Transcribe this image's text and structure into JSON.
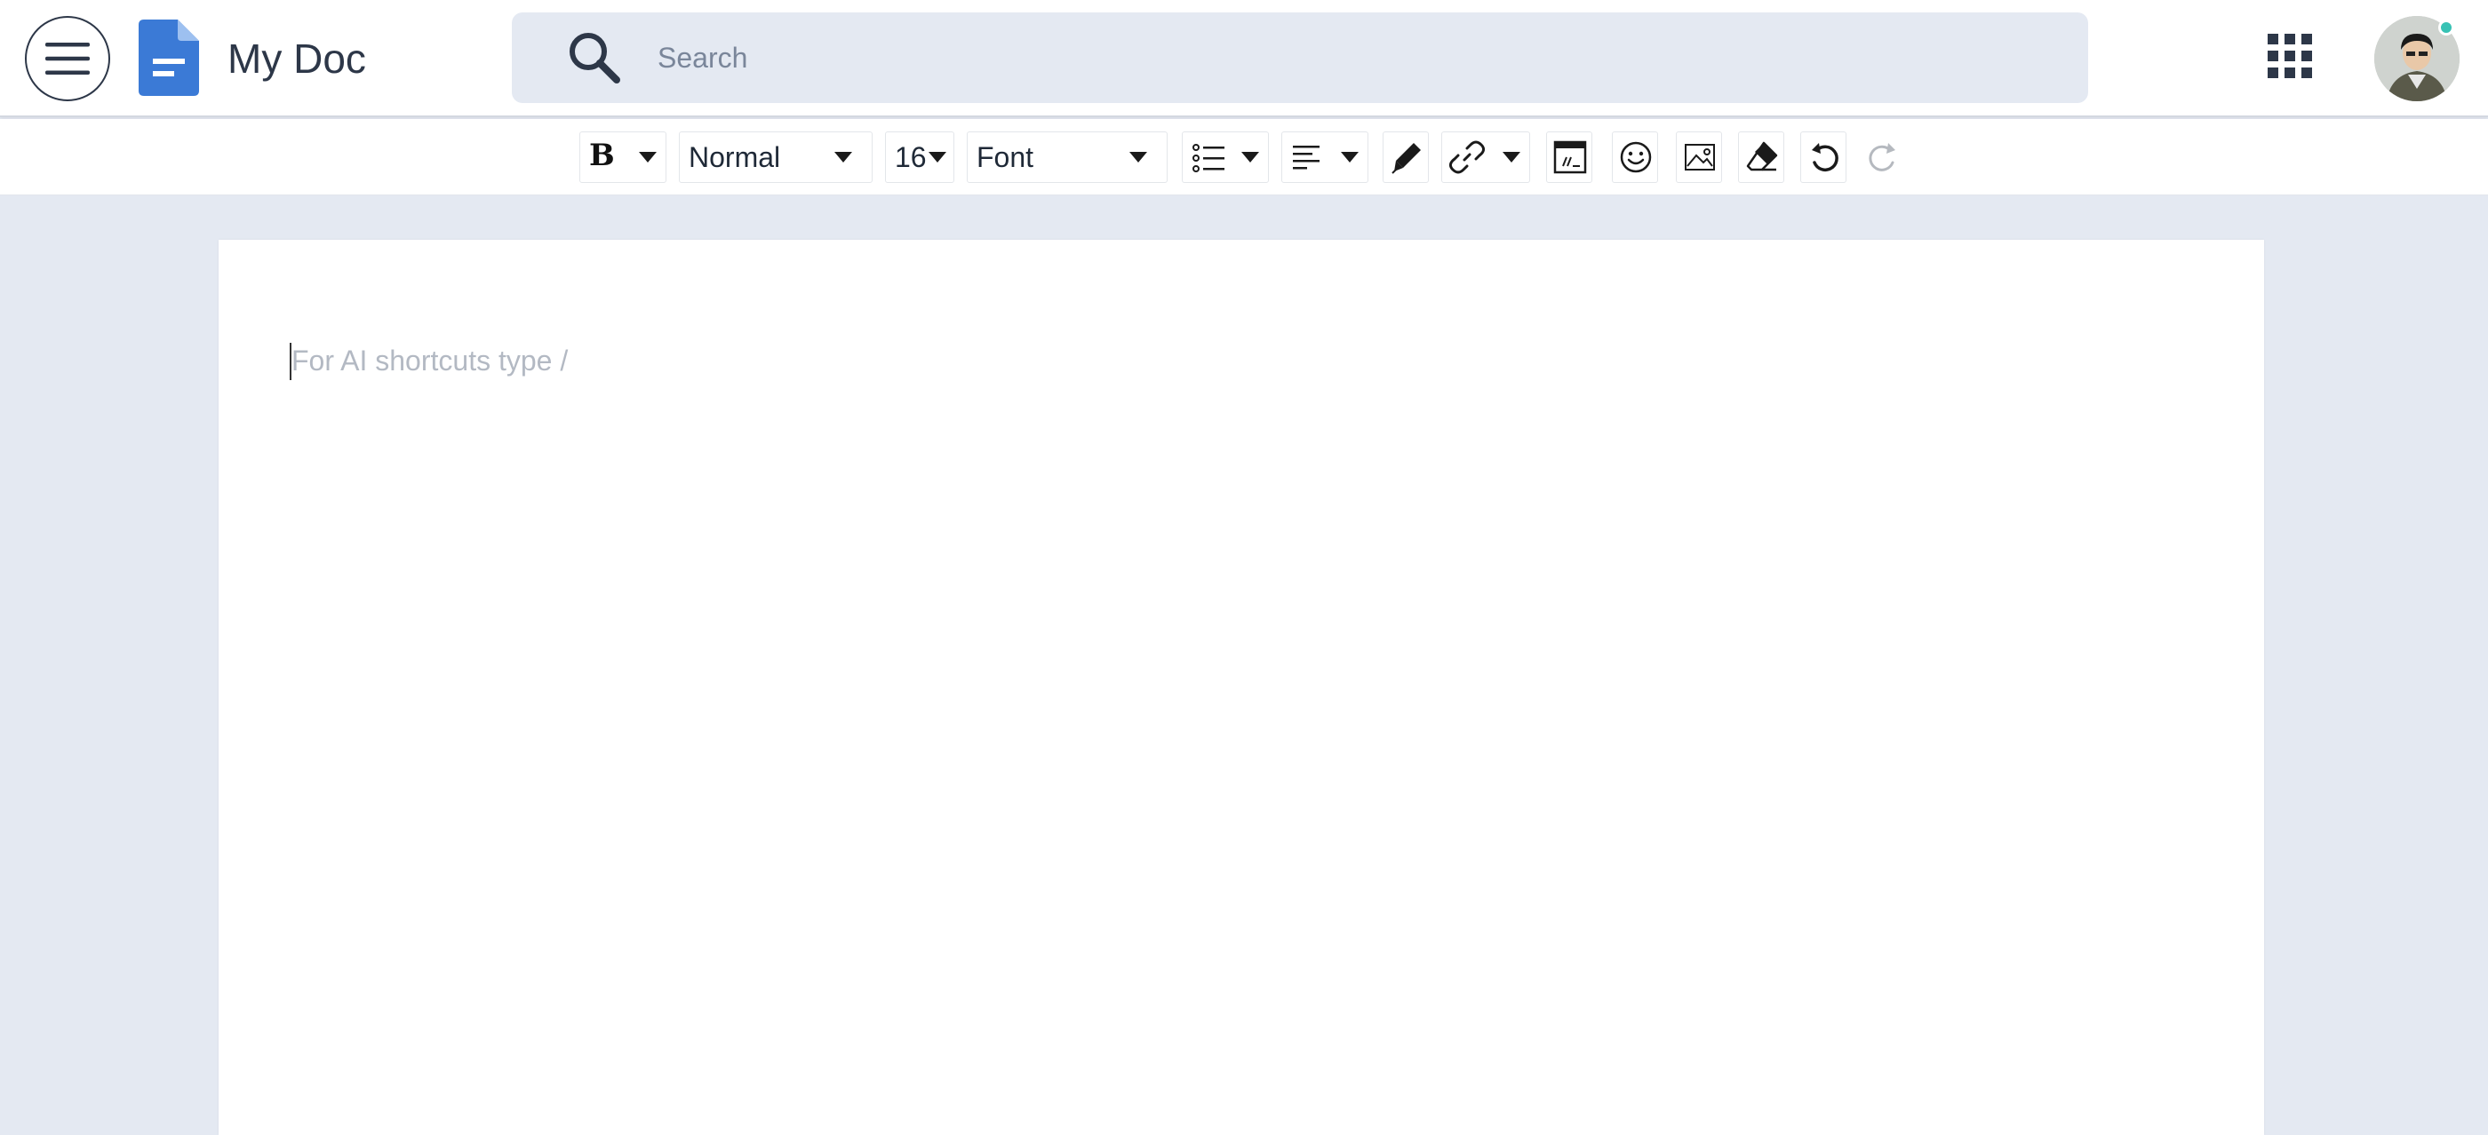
{
  "app": {
    "title": "My Doc",
    "brand_color": "#3b7ad6"
  },
  "header": {
    "menu_icon": "hamburger-menu-icon",
    "search": {
      "placeholder": "Search",
      "value": ""
    },
    "apps_icon": "apps-grid-icon",
    "avatar": {
      "status_color": "#38c2b4"
    }
  },
  "toolbar": {
    "text_style": {
      "icon": "bold-icon"
    },
    "block_type": {
      "value": "Normal"
    },
    "font_size": {
      "value": "16"
    },
    "font_family": {
      "value": "Font"
    },
    "list": {
      "icon": "bulleted-list-icon"
    },
    "align": {
      "icon": "align-left-icon"
    },
    "color": {
      "icon": "pen-icon"
    },
    "link": {
      "icon": "link-icon"
    },
    "code": {
      "icon": "code-block-icon"
    },
    "emoji": {
      "icon": "emoji-icon"
    },
    "image": {
      "icon": "image-icon"
    },
    "clear_format": {
      "icon": "eraser-icon"
    },
    "undo": {
      "icon": "undo-icon"
    },
    "redo": {
      "icon": "redo-icon"
    }
  },
  "editor": {
    "placeholder": "For AI shortcuts type /",
    "content": ""
  }
}
